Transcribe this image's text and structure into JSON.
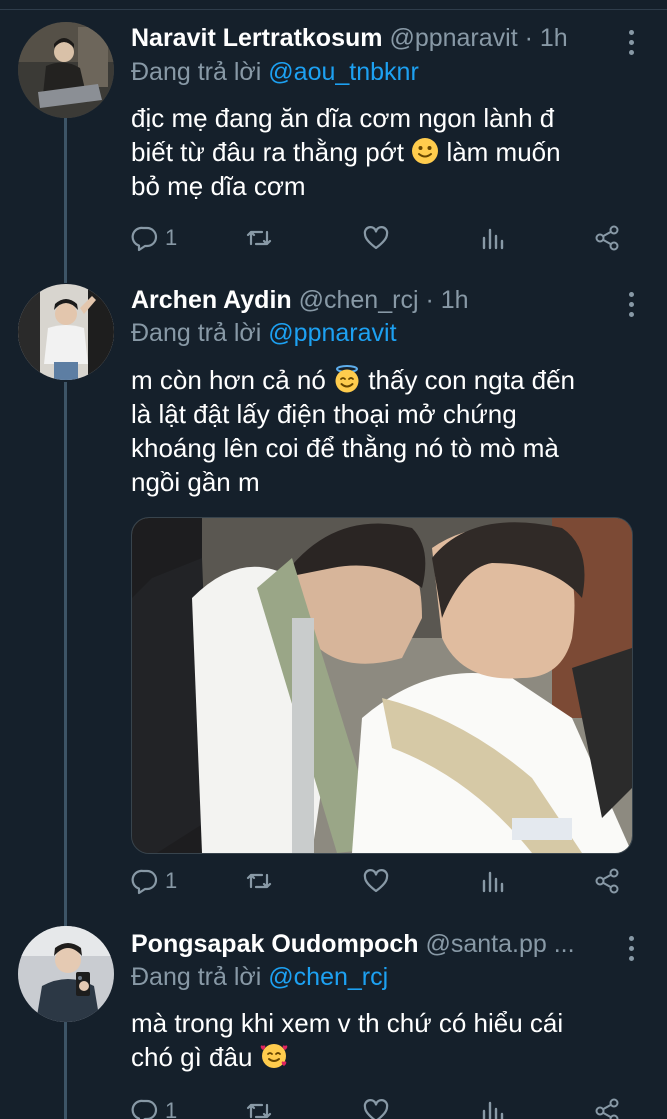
{
  "tweets": [
    {
      "name": "Naravit Lertratkosum",
      "handle": "@ppnaravit",
      "time": "1h",
      "replying_label": "Đang trả lời",
      "replying_to": "@aou_tnbknr",
      "text_lines": [
        "địc mẹ đang ăn dĩa cơm ngon lành đ",
        "biết từ đâu ra thằng pớt",
        "làm muốn",
        "bỏ mẹ dĩa cơm"
      ],
      "reply_count": "1"
    },
    {
      "name": "Archen Aydin",
      "handle": "@chen_rcj",
      "time": "1h",
      "replying_label": "Đang trả lời",
      "replying_to": "@ppnaravit",
      "text_lines": [
        "m còn hơn cả nó",
        "thấy con ngta đến",
        "là lật đật lấy điện thoại mở chứng",
        "khoáng lên coi để thằng nó tò mò mà",
        "ngồi gần m"
      ],
      "reply_count": "1"
    },
    {
      "name": "Pongsapak Oudompoch",
      "handle": "@santa.pp ...",
      "replying_label": "Đang trả lời",
      "replying_to": "@chen_rcj",
      "text_lines": [
        "mà trong khi xem v th chứ có hiểu cái",
        "chó gì đâu"
      ],
      "reply_count": "1"
    }
  ],
  "icons": {
    "reply": "reply-icon",
    "retweet": "retweet-icon",
    "like": "heart-icon",
    "analytics": "analytics-icon",
    "share": "share-icon",
    "more": "more-icon"
  },
  "colors": {
    "background": "#15202b",
    "secondary_text": "#8899a6",
    "mention": "#1da1f2",
    "thread_line": "#3d5466"
  }
}
